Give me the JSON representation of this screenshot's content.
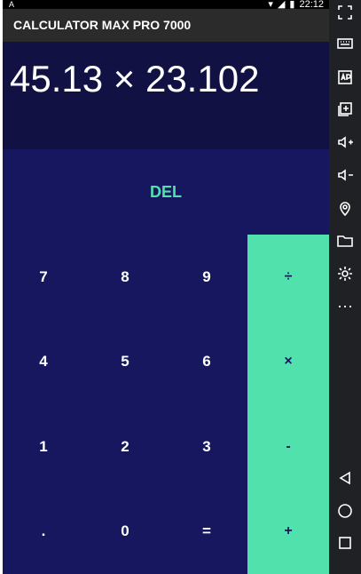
{
  "status_bar": {
    "left_icon": "A",
    "time": "22:12"
  },
  "app_bar": {
    "title": "CALCULATOR MAX PRO 7000"
  },
  "display": {
    "expression": "45.13 × 23.102"
  },
  "controls": {
    "del_label": "DEL"
  },
  "keypad": {
    "rows": [
      [
        "7",
        "8",
        "9",
        "÷"
      ],
      [
        "4",
        "5",
        "6",
        "×"
      ],
      [
        "1",
        "2",
        "3",
        "-"
      ],
      [
        ".",
        "0",
        "=",
        "+"
      ]
    ]
  },
  "sidebar": {
    "icons": [
      "fullscreen-icon",
      "keyboard-icon",
      "apk-icon",
      "add-window-icon",
      "volume-up-icon",
      "volume-down-icon",
      "location-icon",
      "folder-icon",
      "settings-icon",
      "more-icon",
      "back-icon",
      "home-icon",
      "recent-apps-icon"
    ]
  },
  "colors": {
    "accent": "#51e1ad",
    "background": "#16175e",
    "display": "#111144"
  }
}
